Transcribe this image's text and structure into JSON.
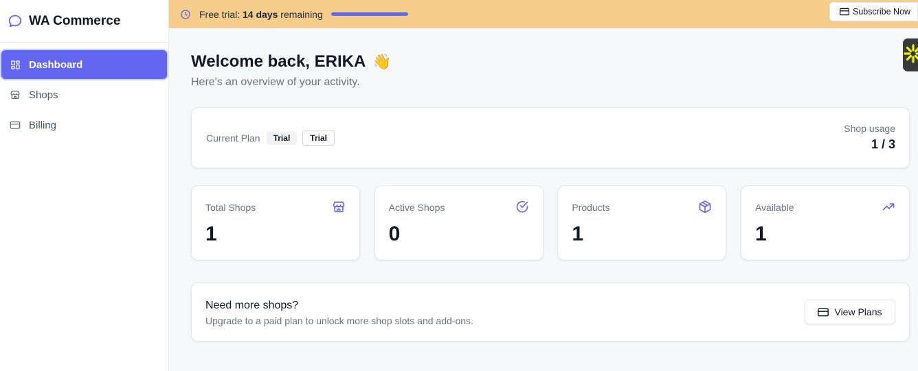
{
  "brand": {
    "name": "WA Commerce",
    "icon": "chat-bubble-icon"
  },
  "sidebar": {
    "items": [
      {
        "label": "Dashboard",
        "icon": "grid-icon",
        "active": true
      },
      {
        "label": "Shops",
        "icon": "store-icon",
        "active": false
      },
      {
        "label": "Billing",
        "icon": "credit-card-icon",
        "active": false
      }
    ]
  },
  "trial_banner": {
    "prefix": "Free trial: ",
    "days": "14 days",
    "suffix": " remaining",
    "subscribe_label": "Subscribe Now",
    "icon": "clock-icon",
    "progress": 1.0
  },
  "main": {
    "welcome": "Welcome back, ERIKA",
    "wave": "👋",
    "subtitle": "Here's an overview of your activity."
  },
  "plan": {
    "label": "Current Plan",
    "badge_1": "Trial",
    "badge_2": "Trial",
    "usage_label": "Shop usage",
    "usage_value": "1 / 3"
  },
  "stats": [
    {
      "label": "Total Shops",
      "value": "1",
      "icon": "store-icon"
    },
    {
      "label": "Active Shops",
      "value": "0",
      "icon": "check-circle-icon"
    },
    {
      "label": "Products",
      "value": "1",
      "icon": "box-icon"
    },
    {
      "label": "Available",
      "value": "1",
      "icon": "trending-up-icon"
    }
  ],
  "upgrade": {
    "title": "Need more shops?",
    "description": "Upgrade to a paid plan to unlock more shop slots and add-ons.",
    "button_label": "View Plans"
  },
  "colors": {
    "accent": "#6366f1",
    "banner": "#f6cd8a",
    "widget": "#3a3a3a",
    "widget_star": "#e8f51a"
  }
}
